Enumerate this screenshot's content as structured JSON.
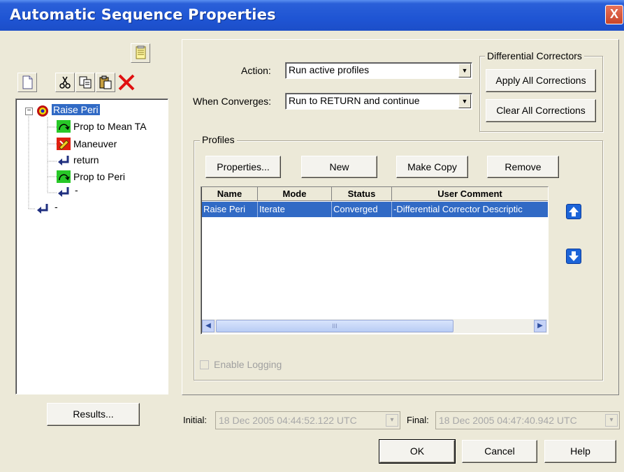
{
  "window": {
    "title": "Automatic Sequence Properties",
    "close_label": "X"
  },
  "tree": {
    "items": [
      {
        "label": "Raise Peri",
        "icon": "target-icon",
        "selected": true
      },
      {
        "label": "Prop to Mean TA",
        "icon": "propagate-icon"
      },
      {
        "label": "Maneuver",
        "icon": "maneuver-icon"
      },
      {
        "label": "return",
        "icon": "return-icon"
      },
      {
        "label": "Prop to Peri",
        "icon": "propagate-icon"
      },
      {
        "label": "-",
        "icon": "return-icon"
      },
      {
        "label": "-",
        "icon": "return-icon"
      }
    ],
    "expander": "−"
  },
  "action": {
    "label": "Action:",
    "value": "Run active profiles"
  },
  "converges": {
    "label": "When Converges:",
    "value": "Run to RETURN and continue"
  },
  "diff_correctors": {
    "title": "Differential Correctors",
    "apply_label": "Apply All Corrections",
    "clear_label": "Clear All Corrections"
  },
  "profiles": {
    "title": "Profiles",
    "buttons": {
      "properties": "Properties...",
      "new": "New",
      "copy": "Make Copy",
      "remove": "Remove"
    },
    "columns": [
      "Name",
      "Mode",
      "Status",
      "User Comment"
    ],
    "rows": [
      {
        "name": "Raise Peri",
        "mode": "Iterate",
        "status": "Converged",
        "comment": "-Differential Corrector Descriptic"
      }
    ],
    "scroll_thumb": "III",
    "enable_logging": "Enable Logging"
  },
  "results_label": "Results...",
  "initial": {
    "label": "Initial:",
    "value": "18 Dec 2005 04:44:52.122 UTC"
  },
  "final": {
    "label": "Final:",
    "value": "18 Dec 2005 04:47:40.942 UTC"
  },
  "footer": {
    "ok": "OK",
    "cancel": "Cancel",
    "help": "Help"
  }
}
